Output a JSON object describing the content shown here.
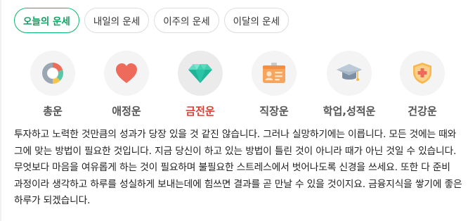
{
  "tabs": [
    {
      "label": "오늘의 운세",
      "active": true
    },
    {
      "label": "내일의 운세",
      "active": false
    },
    {
      "label": "이주의 운세",
      "active": false
    },
    {
      "label": "이달의 운세",
      "active": false
    }
  ],
  "categories": [
    {
      "label": "총운",
      "icon": "donut-chart-icon",
      "active": false
    },
    {
      "label": "애정운",
      "icon": "heart-icon",
      "active": false
    },
    {
      "label": "금전운",
      "icon": "diamond-icon",
      "active": true
    },
    {
      "label": "직장운",
      "icon": "id-badge-icon",
      "active": false
    },
    {
      "label": "학업,성적운",
      "icon": "graduation-cap-icon",
      "active": false
    },
    {
      "label": "건강운",
      "icon": "health-shield-icon",
      "active": false
    }
  ],
  "colors": {
    "accent_green": "#10b66e",
    "active_label_red": "#e53935"
  },
  "fortune_text": "투자하고 노력한 것만큼의 성과가 당장 있을 것 같진 않습니다. 그러나 실망하기에는 이릅니다. 모든 것에는 때와 그에 맞는 방법이 필요한 것입니다. 지금 당신이 하고 있는 방법이 틀린 것이 아니라 때가 아닌 것일 수 있습니다. 무엇보다 마음을 여유롭게 하는 것이 필요하며 불필요한 스트레스에서 벗어나도록 신경을 쓰세요. 또한 다 준비 과정이라 생각하고 하루를 성실하게 보내는데에 힘쓰면 결과를 곧 만날 수 있을 것이지요. 금융지식을 쌓기에 좋은 하루가 되겠습니다."
}
